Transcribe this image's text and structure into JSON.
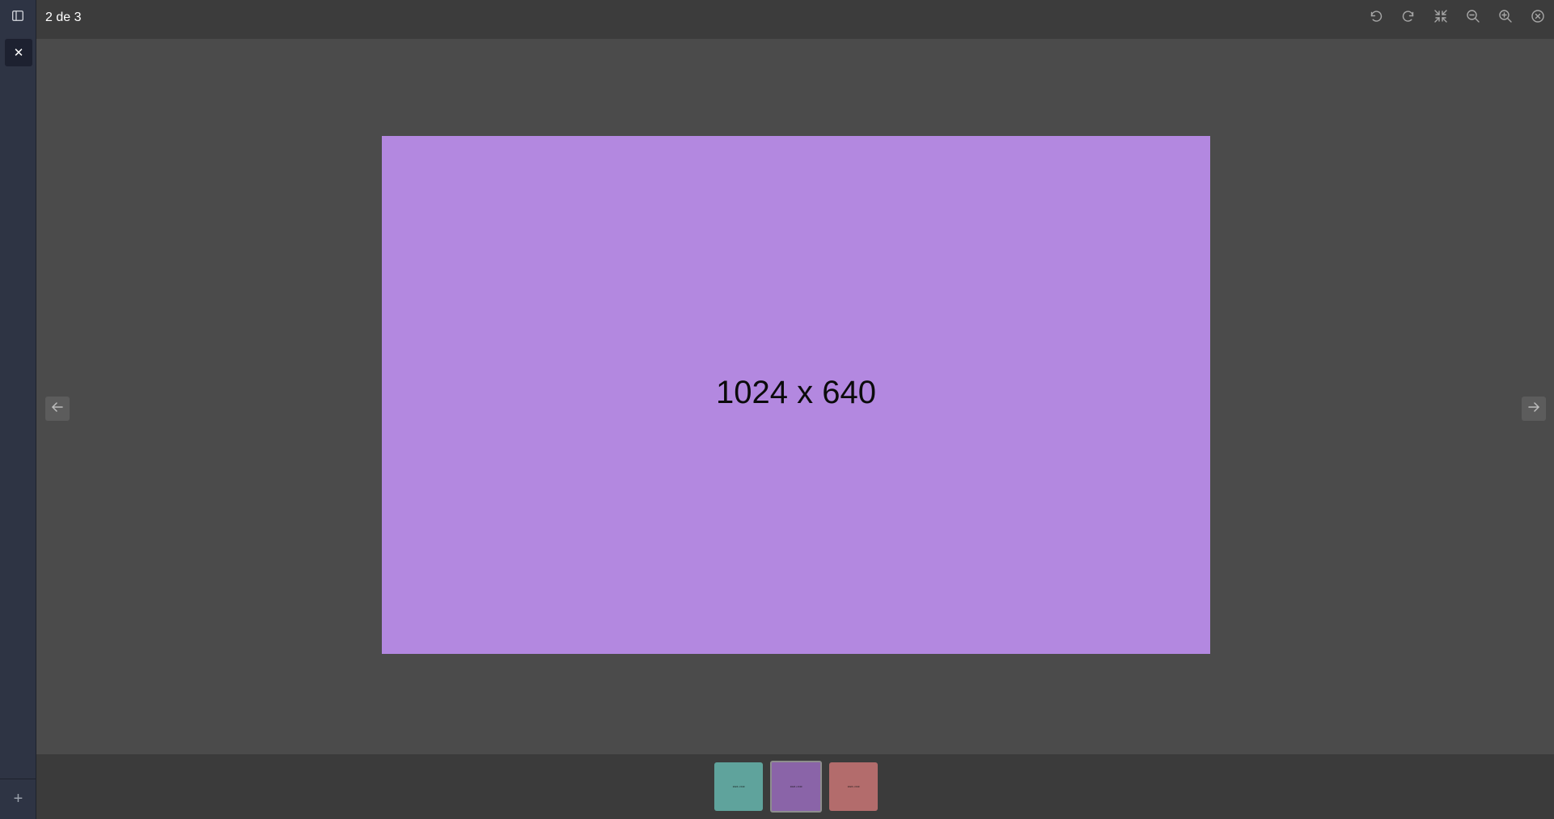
{
  "viewer": {
    "counter": "2 de 3",
    "image_text": "1024 x 640",
    "image_color": "#b388e0"
  },
  "sidebar": {
    "toggle_icon": "sidebar-panel-icon",
    "close_icon": "close-icon",
    "close_label": "✕",
    "add_icon": "plus-icon",
    "add_label": "+"
  },
  "toolbar": {
    "tools": [
      {
        "name": "rotate-left-icon"
      },
      {
        "name": "rotate-right-icon"
      },
      {
        "name": "shrink-icon"
      },
      {
        "name": "zoom-out-icon"
      },
      {
        "name": "zoom-in-icon"
      },
      {
        "name": "close-circle-icon"
      }
    ]
  },
  "navigation": {
    "prev_icon": "arrow-left-icon",
    "next_icon": "arrow-right-icon"
  },
  "thumbnails": [
    {
      "label": "1024 x 640",
      "color": "#5fa39c",
      "selected": false
    },
    {
      "label": "1024 x 640",
      "color": "#8a64a8",
      "selected": true
    },
    {
      "label": "1024 x 640",
      "color": "#b36c6c",
      "selected": false
    }
  ]
}
